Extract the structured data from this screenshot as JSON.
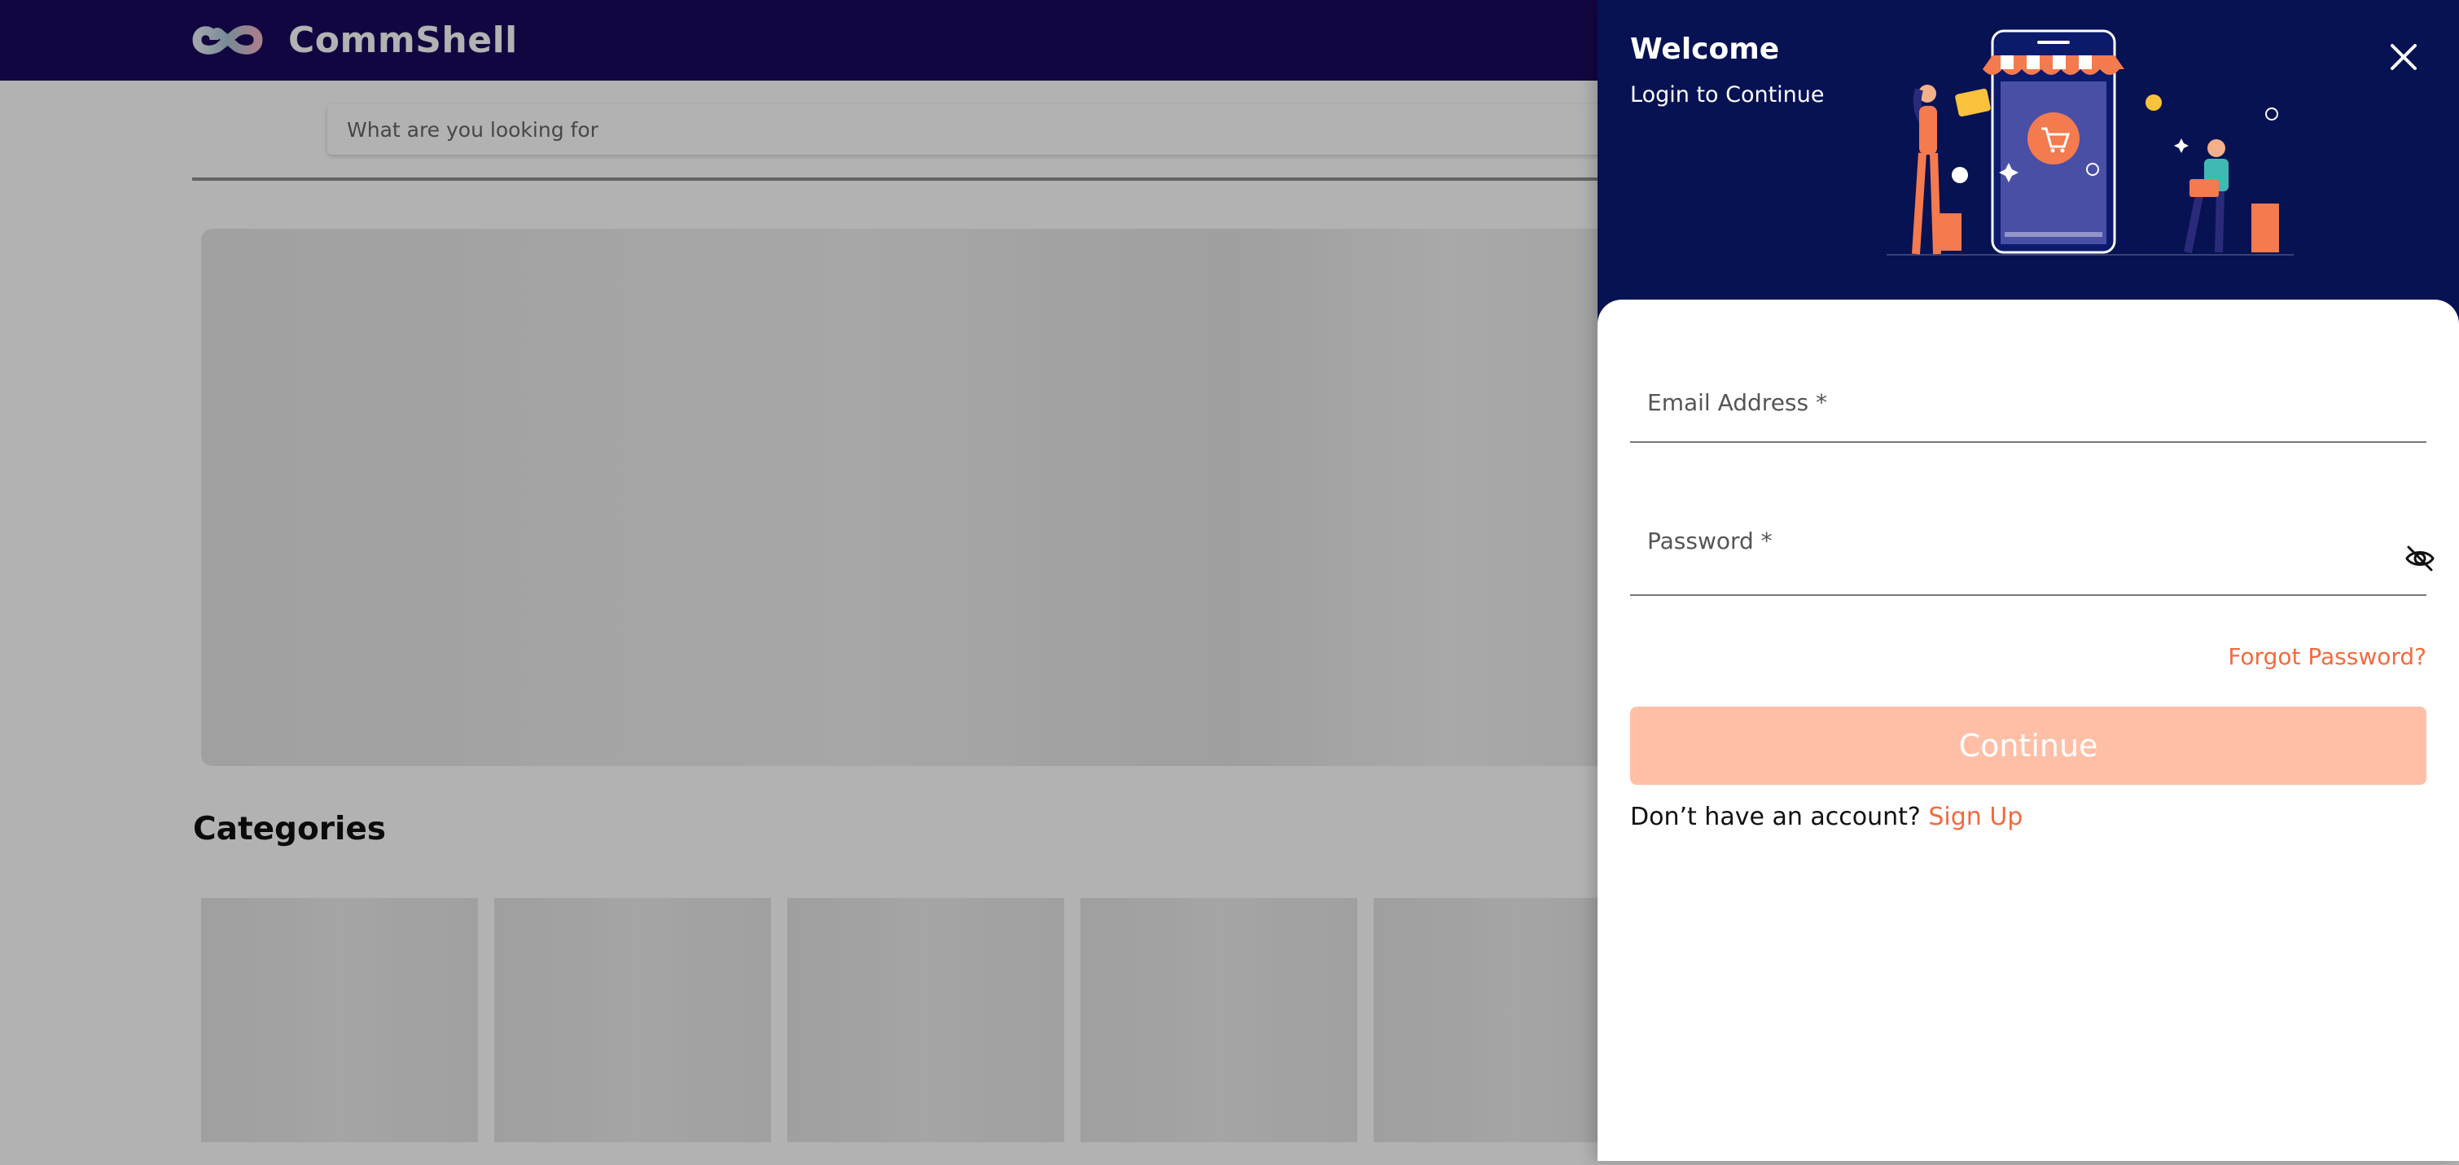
{
  "app": {
    "brand_name": "CommShell"
  },
  "search": {
    "placeholder": "What are you looking for"
  },
  "main": {
    "categories_title": "Categories"
  },
  "login_drawer": {
    "title": "Welcome",
    "subtitle": "Login to Continue",
    "email_label": "Email Address *",
    "password_label": "Password *",
    "forgot_password": "Forgot Password?",
    "continue_label": "Continue",
    "no_account_text": "Don’t have an account?",
    "sign_up_label": "Sign Up"
  },
  "colors": {
    "topbar": "#1a0a5e",
    "drawer_header": "#071252",
    "accent": "#f26a3e",
    "continue_disabled": "#ffbfa6"
  },
  "icons": [
    "infinity-logo-icon",
    "close-icon",
    "eye-off-icon",
    "shopping-illustration"
  ]
}
